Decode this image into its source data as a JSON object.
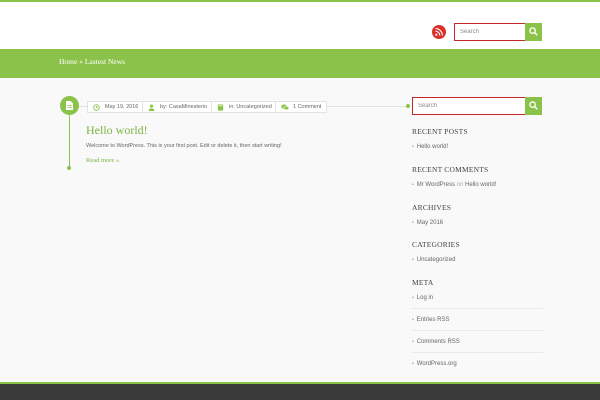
{
  "colors": {
    "accent": "#8bc34a",
    "rss": "#d9302b",
    "search_border": "#c62828",
    "footer": "#3a3a3a"
  },
  "header": {
    "rss_icon": "rss-icon",
    "search": {
      "placeholder": "Search",
      "button_icon": "magnifier-icon"
    }
  },
  "breadcrumb": {
    "text": "Home » Lastest News"
  },
  "post": {
    "icon": "document-icon",
    "date": "May 19, 2016",
    "author": "by: CasaMinesterio",
    "category": "in: Uncategorized",
    "comments": "1 Comment",
    "title": "Hello world!",
    "excerpt": "Welcome to WordPress. This is your first post. Edit or delete it, then start writing!",
    "read_more": "Read more »"
  },
  "sidebar": {
    "search": {
      "placeholder": "Search",
      "button_icon": "magnifier-icon"
    },
    "recent_posts": {
      "title": "RECENT POSTS",
      "items": [
        "Hello world!"
      ]
    },
    "recent_comments": {
      "title": "RECENT COMMENTS",
      "author": "Mr WordPress",
      "on": "on",
      "post": "Hello world!"
    },
    "archives": {
      "title": "ARCHIVES",
      "items": [
        "May 2016"
      ]
    },
    "categories": {
      "title": "CATEGORIES",
      "items": [
        "Uncategorized"
      ]
    },
    "meta": {
      "title": "META",
      "items": [
        "Log in",
        "Entries RSS",
        "Comments RSS",
        "WordPress.org"
      ]
    }
  }
}
